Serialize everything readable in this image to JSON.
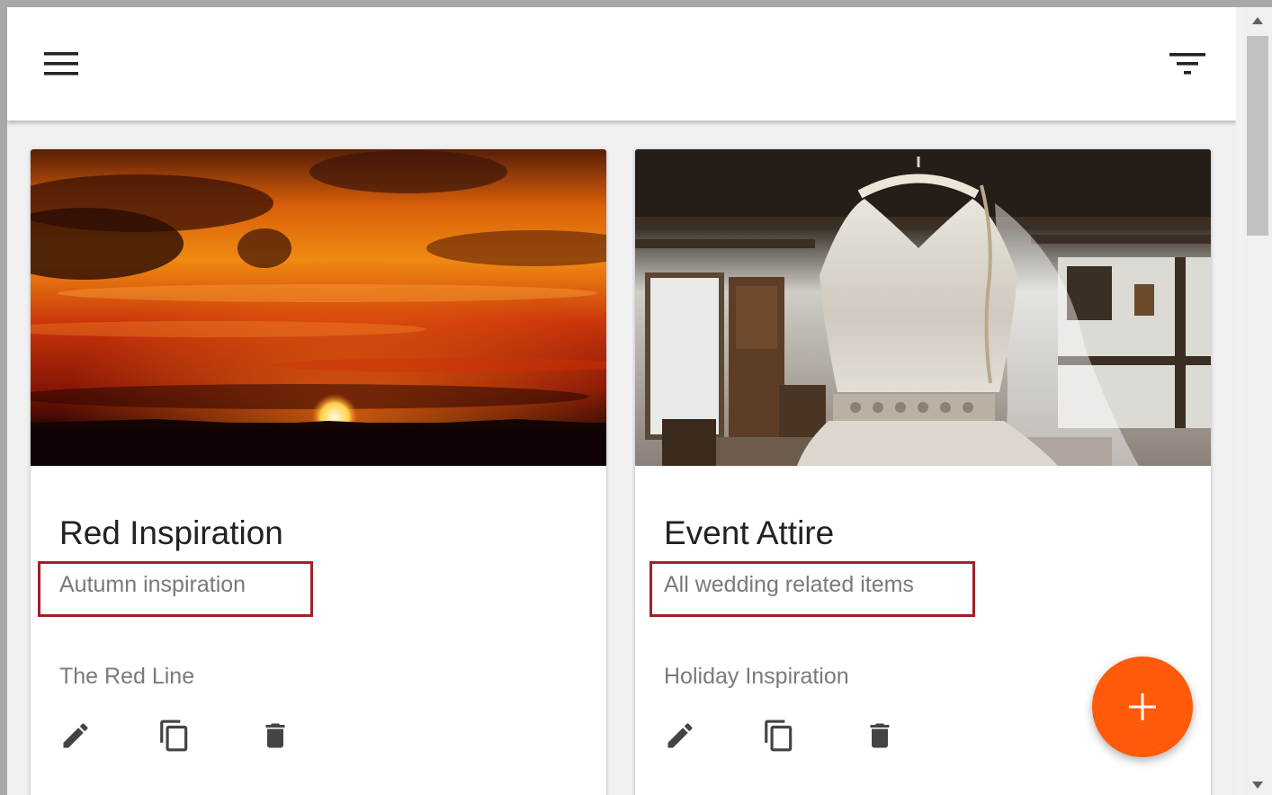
{
  "app_bar": {
    "menu_icon": "hamburger-menu-icon",
    "filter_icon": "filter-list-icon"
  },
  "cards": [
    {
      "title": "Red Inspiration",
      "description": "Autumn inspiration",
      "collection": "The Red Line",
      "image": "sunset-photo"
    },
    {
      "title": "Event Attire",
      "description": "All wedding related items",
      "collection": "Holiday Inspiration",
      "image": "wedding-dress-photo"
    }
  ],
  "card_actions": [
    "edit-icon",
    "copy-icon",
    "delete-icon"
  ],
  "fab": {
    "icon": "plus-icon"
  },
  "colors": {
    "accent": "#ff5a0a",
    "highlight_border": "#a1202a",
    "title_text": "#222222",
    "secondary_text": "#7a7a7a"
  }
}
